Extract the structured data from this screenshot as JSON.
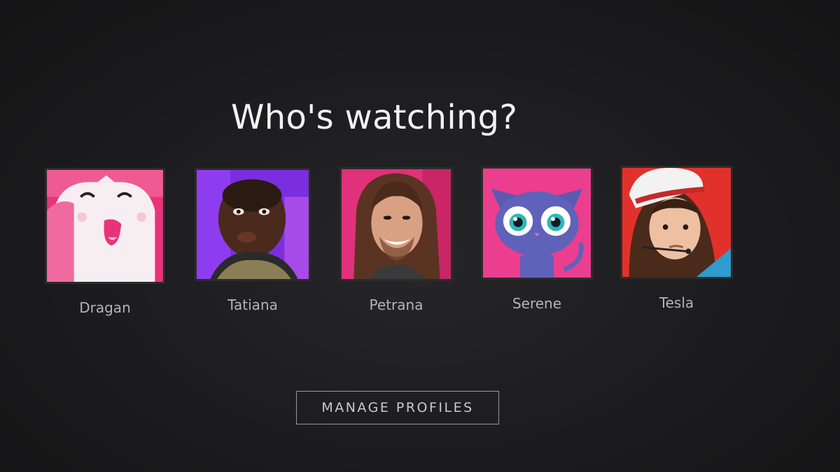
{
  "heading": "Who's watching?",
  "profiles": [
    {
      "name": "Dragan",
      "avatar_icon": "pink-cartoon-face-icon",
      "accent": "#e8337a"
    },
    {
      "name": "Tatiana",
      "avatar_icon": "smiling-man-purple-bg-icon",
      "accent": "#8a2bd9"
    },
    {
      "name": "Petrana",
      "avatar_icon": "long-haired-man-pink-bg-icon",
      "accent": "#d82a6a"
    },
    {
      "name": "Serene",
      "avatar_icon": "purple-cat-icon",
      "accent": "#ec3e8f"
    },
    {
      "name": "Tesla",
      "avatar_icon": "boy-cap-red-bg-icon",
      "accent": "#e2312b"
    }
  ],
  "manage_button": "MANAGE PROFILES"
}
